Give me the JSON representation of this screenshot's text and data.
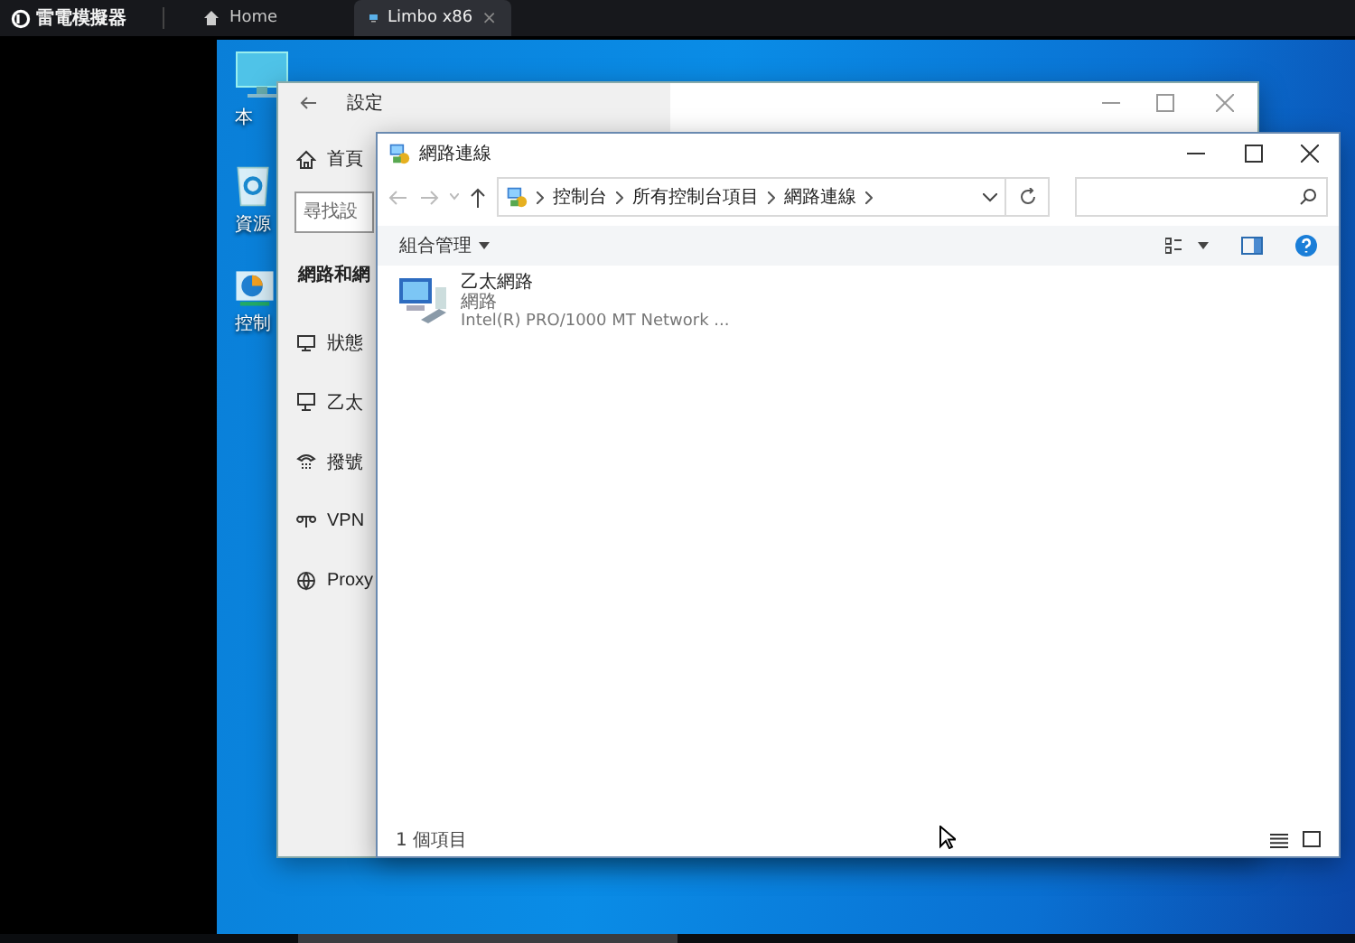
{
  "app_bar": {
    "logo": "雷電模擬器",
    "close_glyph": "×",
    "tabs": [
      {
        "label": "Home",
        "selected": false,
        "closable": false
      },
      {
        "label": "Limbo x86",
        "selected": true,
        "closable": true
      }
    ]
  },
  "desktop_icons": [
    {
      "label": "本"
    },
    {
      "label": "資源"
    },
    {
      "label": "控制"
    }
  ],
  "settings_window": {
    "title": "設定",
    "home": "首頁",
    "search": {
      "placeholder": "尋找設"
    },
    "section": "網路和網",
    "items": [
      {
        "label": "狀態"
      },
      {
        "label": "乙太"
      },
      {
        "label": "撥號"
      },
      {
        "label": "VPN"
      },
      {
        "label": "Proxy"
      }
    ]
  },
  "explorer": {
    "title": "網路連線",
    "breadcrumb": [
      "控制台",
      "所有控制台項目",
      "網路連線"
    ],
    "organize": "組合管理",
    "items": [
      {
        "name": "乙太網路",
        "status": "網路",
        "device": "Intel(R) PRO/1000 MT Network ..."
      }
    ],
    "status_bar": "1 個項目"
  }
}
